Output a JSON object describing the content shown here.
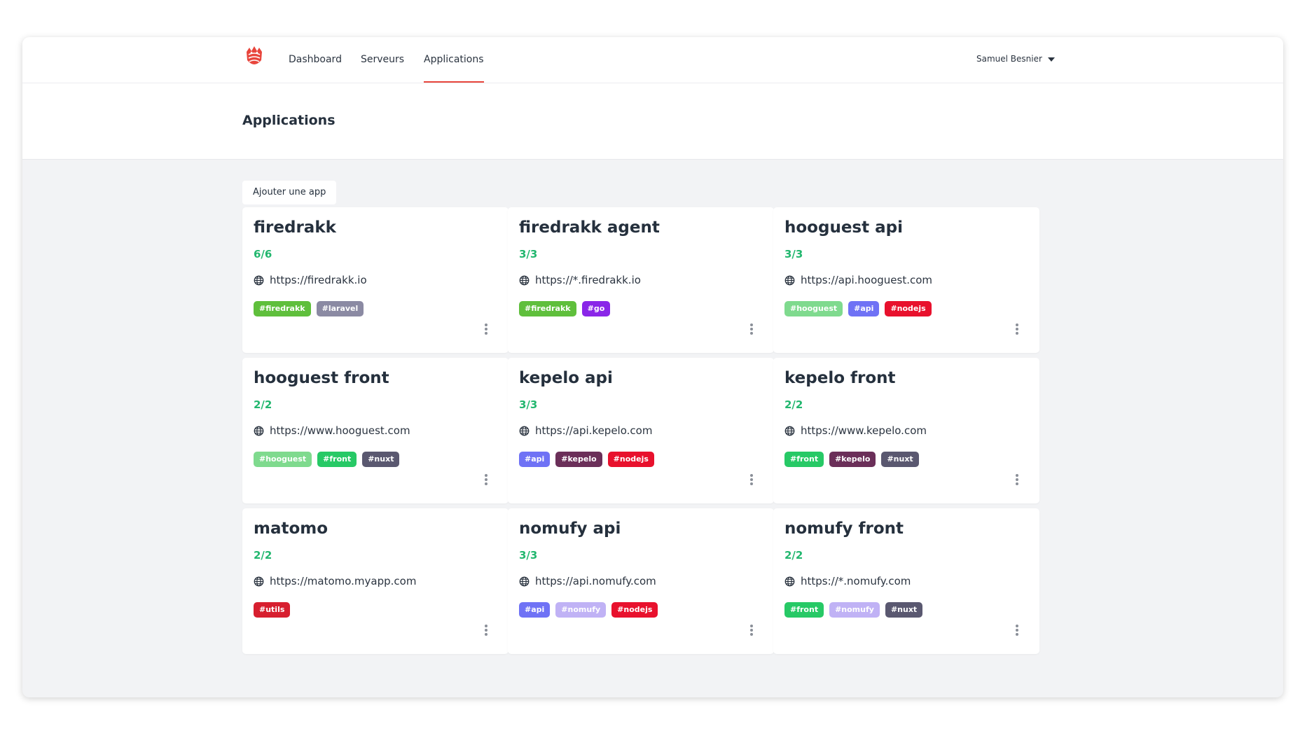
{
  "nav": {
    "logo": "firedrakk-logo",
    "links": [
      {
        "label": "Dashboard"
      },
      {
        "label": "Serveurs"
      },
      {
        "label": "Applications",
        "active": true
      }
    ],
    "user": {
      "name": "Samuel Besnier"
    }
  },
  "page": {
    "title": "Applications",
    "add_button_label": "Ajouter une app"
  },
  "colors": {
    "accent": "#e8453c",
    "count_green": "#23b76f"
  },
  "apps": [
    {
      "name": "firedrakk",
      "count": "6/6",
      "url": "https://firedrakk.io",
      "tags": [
        {
          "label": "#firedrakk",
          "color": "#5fbf3c"
        },
        {
          "label": "#laravel",
          "color": "#8b8aa3"
        }
      ]
    },
    {
      "name": "firedrakk agent",
      "count": "3/3",
      "url": "https://*.firedrakk.io",
      "tags": [
        {
          "label": "#firedrakk",
          "color": "#5fbf3c"
        },
        {
          "label": "#go",
          "color": "#8a26e8"
        }
      ]
    },
    {
      "name": "hooguest api",
      "count": "3/3",
      "url": "https://api.hooguest.com",
      "tags": [
        {
          "label": "#hooguest",
          "color": "#7fda8e"
        },
        {
          "label": "#api",
          "color": "#6f72f5"
        },
        {
          "label": "#nodejs",
          "color": "#e8112d"
        }
      ]
    },
    {
      "name": "hooguest front",
      "count": "2/2",
      "url": "https://www.hooguest.com",
      "tags": [
        {
          "label": "#hooguest",
          "color": "#7fda8e"
        },
        {
          "label": "#front",
          "color": "#27c966"
        },
        {
          "label": "#nuxt",
          "color": "#5a5870"
        }
      ]
    },
    {
      "name": "kepelo api",
      "count": "3/3",
      "url": "https://api.kepelo.com",
      "tags": [
        {
          "label": "#api",
          "color": "#6f72f5"
        },
        {
          "label": "#kepelo",
          "color": "#6b2f59"
        },
        {
          "label": "#nodejs",
          "color": "#e8112d"
        }
      ]
    },
    {
      "name": "kepelo front",
      "count": "2/2",
      "url": "https://www.kepelo.com",
      "tags": [
        {
          "label": "#front",
          "color": "#27c966"
        },
        {
          "label": "#kepelo",
          "color": "#6b2f59"
        },
        {
          "label": "#nuxt",
          "color": "#5a5870"
        }
      ]
    },
    {
      "name": "matomo",
      "count": "2/2",
      "url": "https://matomo.myapp.com",
      "tags": [
        {
          "label": "#utils",
          "color": "#d71f2f"
        }
      ]
    },
    {
      "name": "nomufy api",
      "count": "3/3",
      "url": "https://api.nomufy.com",
      "tags": [
        {
          "label": "#api",
          "color": "#6f72f5"
        },
        {
          "label": "#nomufy",
          "color": "#c0b2f5"
        },
        {
          "label": "#nodejs",
          "color": "#e8112d"
        }
      ]
    },
    {
      "name": "nomufy front",
      "count": "2/2",
      "url": "https://*.nomufy.com",
      "tags": [
        {
          "label": "#front",
          "color": "#27c966"
        },
        {
          "label": "#nomufy",
          "color": "#c0b2f5"
        },
        {
          "label": "#nuxt",
          "color": "#5a5870"
        }
      ]
    }
  ]
}
